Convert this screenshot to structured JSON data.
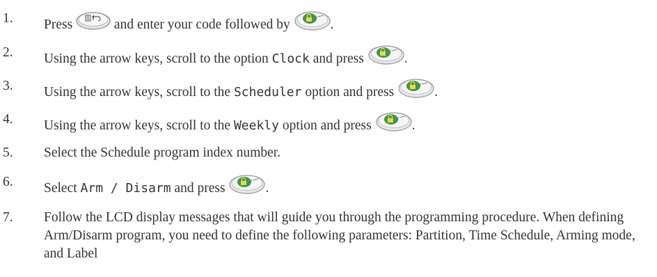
{
  "steps": [
    {
      "number": "1.",
      "pre": "Press",
      "mid": "and enter your code followed by",
      "post": "."
    },
    {
      "number": "2.",
      "pre": "Using the arrow keys, scroll to the option",
      "code": "Clock",
      "post": "and press",
      "end": "."
    },
    {
      "number": "3.",
      "pre": "Using the arrow keys, scroll to the",
      "code": "Scheduler",
      "post": "option and press",
      "end": "."
    },
    {
      "number": "4.",
      "pre": "Using the arrow keys, scroll to the",
      "code": "Weekly",
      "post": "option and press",
      "end": "."
    },
    {
      "number": "5.",
      "text": "Select the Schedule program index number."
    },
    {
      "number": "6.",
      "pre": "Select",
      "code": "Arm / Disarm",
      "post": "and press",
      "end": "."
    },
    {
      "number": "7.",
      "text": "Follow the LCD display messages that will guide you through the programming procedure. When defining Arm/Disarm program, you need to define the following parameters: Partition, Time Schedule, Arming mode, and Label"
    }
  ],
  "icons": {
    "menu_key": "menu-back-key-icon",
    "ok_key": "ok-arm-key-icon"
  },
  "colors": {
    "ok_key_green": "#3a9a4a",
    "key_grey": "#b9b9b9"
  }
}
